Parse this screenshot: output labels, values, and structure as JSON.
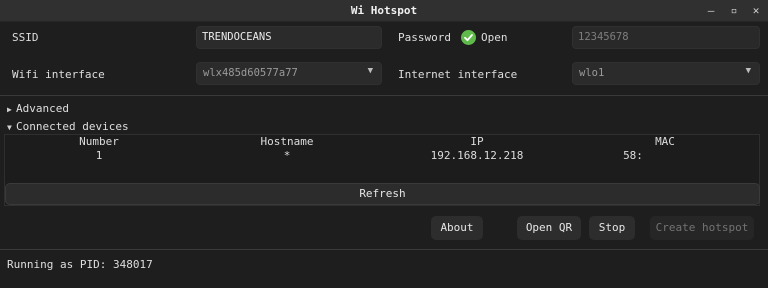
{
  "window": {
    "title": "Wi Hotspot",
    "controls": {
      "minimize": "–",
      "maximize": "▫",
      "close": "✕"
    }
  },
  "form": {
    "ssid_label": "SSID",
    "ssid_value": "TRENDOCEANS",
    "password_label": "Password",
    "open_label": "Open",
    "open_checked": true,
    "password_value": "12345678",
    "wifi_interface_label": "Wifi interface",
    "wifi_interface_value": "wlx485d60577a77",
    "internet_interface_label": "Internet interface",
    "internet_interface_value": "wlo1"
  },
  "advanced": {
    "label": "Advanced",
    "expanded": false,
    "arrow": "▶"
  },
  "connected_devices": {
    "label": "Connected devices",
    "expanded": true,
    "arrow": "▼",
    "columns": [
      "Number",
      "Hostname",
      "IP",
      "MAC"
    ],
    "rows": [
      {
        "number": "1",
        "hostname": "*",
        "ip": "192.168.12.218",
        "mac": "58:"
      }
    ],
    "refresh_label": "Refresh"
  },
  "buttons": {
    "about": "About",
    "open_qr": "Open QR",
    "stop": "Stop",
    "create_hotspot": "Create hotspot"
  },
  "status": "Running as PID: 348017",
  "colors": {
    "background": "#1e1e1e",
    "accent_check": "#5fba4b"
  },
  "icons": {
    "check": "check-circle-icon",
    "caret": "chevron-down-icon"
  }
}
